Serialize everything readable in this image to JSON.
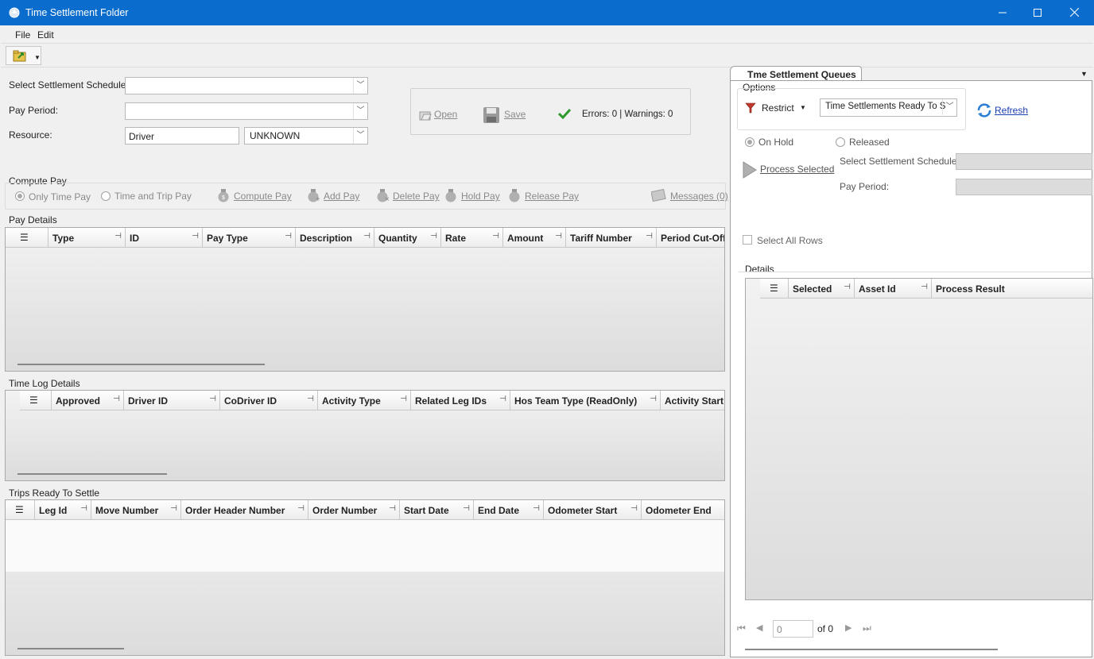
{
  "window": {
    "title": "Time Settlement Folder"
  },
  "menu": [
    "File",
    "Edit"
  ],
  "form": {
    "settlement_schedule_label": "Select Settlement Schedule:",
    "settlement_schedule_value": "",
    "pay_period_label": "Pay Period:",
    "pay_period_value": "",
    "resource_label": "Resource:",
    "resource_type": "Driver",
    "resource_value": "UNKNOWN"
  },
  "actions": {
    "open": "Open",
    "save": "Save",
    "status": "Errors: 0 | Warnings: 0"
  },
  "compute": {
    "section_label": "Compute Pay",
    "only_time_pay": "Only Time Pay",
    "time_and_trip_pay": "Time and Trip Pay",
    "compute_pay": "Compute Pay",
    "add_pay": "Add Pay",
    "delete_pay": "Delete Pay",
    "hold_pay": "Hold Pay",
    "release_pay": "Release Pay",
    "messages": "Messages (0)"
  },
  "pay_details": {
    "title": "Pay Details",
    "columns": [
      "Type",
      "ID",
      "Pay Type",
      "Description",
      "Quantity",
      "Rate",
      "Amount",
      "Tariff Number",
      "Period Cut-Off"
    ]
  },
  "time_log": {
    "title": "Time Log Details",
    "columns": [
      "Approved",
      "Driver ID",
      "CoDriver ID",
      "Activity Type",
      "Related Leg IDs",
      "Hos Team Type (ReadOnly)",
      "Activity Start"
    ]
  },
  "trips": {
    "title": "Trips Ready To Settle",
    "columns": [
      "Leg Id",
      "Move Number",
      "Order Header Number",
      "Order Number",
      "Start Date",
      "End Date",
      "Odometer Start",
      "Odometer End"
    ]
  },
  "queues": {
    "tab": "Tme Settlement Queues",
    "options_label": "Options",
    "restrict": "Restrict",
    "queue_value": "Time Settlements Ready To S",
    "refresh": "Refresh",
    "on_hold": "On Hold",
    "released": "Released",
    "process_selected": "Process Selected",
    "settlement_schedule_label": "Select Settlement Schedule:",
    "pay_period_label": "Pay Period:",
    "select_all_rows": "Select All Rows",
    "details_label": "Details",
    "columns": [
      "Selected",
      "Asset Id",
      "Process Result"
    ],
    "pager": {
      "page": "0",
      "of": "of 0"
    }
  }
}
